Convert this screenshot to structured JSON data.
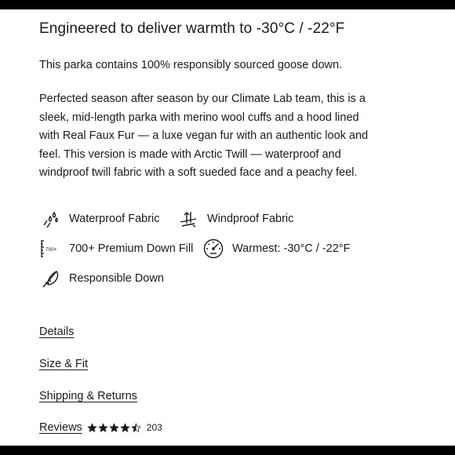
{
  "headline": "Engineered to deliver warmth to -30°C / -22°F",
  "intro": "This parka contains 100% responsibly sourced goose down.",
  "description": "Perfected season after season by our Climate Lab team, this is a sleek, mid-length parka with merino wool cuffs and a hood lined with Real Faux Fur  — a luxe vegan fur with an authentic look and feel. This version is made with Arctic Twill — waterproof and windproof twill fabric with a soft sueded face and a peachy feel.",
  "features": [
    {
      "label": "Waterproof Fabric",
      "icon": "water-drops-icon"
    },
    {
      "label": "Windproof Fabric",
      "icon": "wind-icon"
    },
    {
      "label": "700+ Premium Down Fill",
      "icon": "down-fill-scale-icon",
      "icon_text": "700+"
    },
    {
      "label": "Warmest: -30°C / -22°F",
      "icon": "gauge-icon"
    },
    {
      "label": "Responsible Down",
      "icon": "feather-icon"
    }
  ],
  "links": {
    "details": "Details",
    "size_fit": "Size & Fit",
    "shipping_returns": "Shipping & Returns",
    "reviews": "Reviews"
  },
  "reviews": {
    "rating": 4.5,
    "max": 5,
    "count": "203"
  },
  "colors": {
    "text": "#1a1a1a",
    "frame": "#000000"
  }
}
